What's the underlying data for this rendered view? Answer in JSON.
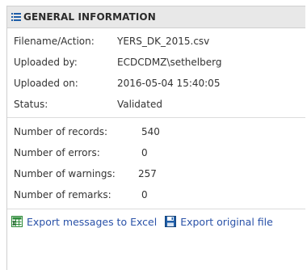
{
  "panel": {
    "title": "GENERAL INFORMATION",
    "title_icon": "list-icon"
  },
  "file_info": [
    {
      "label": "Filename/Action:",
      "value": "YERS_DK_2015.csv"
    },
    {
      "label": "Uploaded by:",
      "value": "ECDCDMZ\\sethelberg"
    },
    {
      "label": "Uploaded on:",
      "value": "2016-05-04 15:40:05"
    },
    {
      "label": "Status:",
      "value": "Validated"
    }
  ],
  "stats": [
    {
      "label": "Number of records:",
      "value": "540"
    },
    {
      "label": "Number of errors:",
      "value": "0"
    },
    {
      "label": "Number of warnings:",
      "value": "257"
    },
    {
      "label": "Number of remarks:",
      "value": "0"
    }
  ],
  "actions": {
    "export_messages": {
      "label": "Export messages to Excel",
      "icon": "excel-icon"
    },
    "export_original": {
      "label": "Export original file",
      "icon": "save-disk-icon"
    }
  },
  "colors": {
    "header_bg": "#e8e8e8",
    "link": "#2a52a8",
    "icon_blue": "#1f5ea8",
    "excel_green": "#2e8b3a"
  }
}
